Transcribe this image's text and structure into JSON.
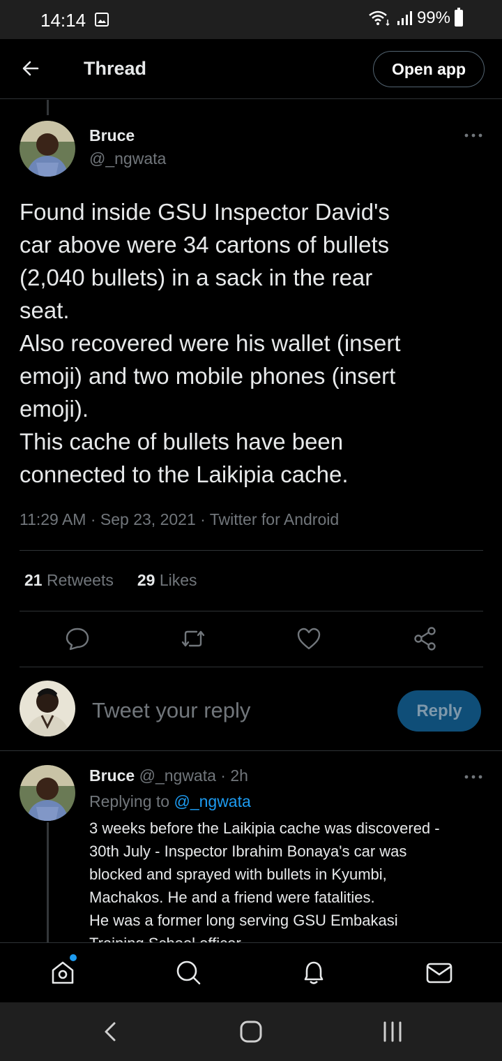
{
  "status_bar": {
    "time": "14:14",
    "battery": "99%"
  },
  "header": {
    "title": "Thread",
    "open_app_label": "Open app"
  },
  "main_tweet": {
    "author_name": "Bruce",
    "author_handle": "@_ngwata",
    "text": "Found inside GSU Inspector David's\ncar above were 34 cartons of bullets\n(2,040 bullets) in a sack in the rear\nseat.\nAlso recovered were his wallet (insert\nemoji) and two mobile phones (insert\nemoji).\nThis cache of bullets have been\nconnected to the Laikipia cache.",
    "meta": "11:29 AM · Sep 23, 2021 · Twitter for Android",
    "retweets_count": "21",
    "retweets_label": "Retweets",
    "likes_count": "29",
    "likes_label": "Likes"
  },
  "composer": {
    "placeholder": "Tweet your reply",
    "reply_label": "Reply"
  },
  "reply_tweet": {
    "author_name": "Bruce",
    "handle_time": "@_ngwata · 2h",
    "replying_to_prefix": "Replying to",
    "replying_to_handle": "@_ngwata",
    "text": "3 weeks before the Laikipia cache was discovered -\n30th July - Inspector Ibrahim Bonaya's car was\nblocked and sprayed with bullets in Kyumbi,\nMachakos. He and a friend were fatalities.\nHe was a former long serving GSU Embakasi\nTraining School officer"
  },
  "colors": {
    "background": "#000000",
    "text_primary": "#e7e9ea",
    "text_secondary": "#71767b",
    "accent": "#1d9bf0",
    "divider": "#2f3336",
    "reply_button_disabled": "#0f4e78"
  },
  "icons": {
    "back": "arrow-left-icon",
    "more": "more-horizontal-icon",
    "reply": "reply-bubble-icon",
    "retweet": "retweet-icon",
    "like": "heart-icon",
    "share": "share-icon",
    "nav_home": "home-icon",
    "nav_search": "search-icon",
    "nav_notifications": "bell-icon",
    "nav_messages": "envelope-icon"
  }
}
